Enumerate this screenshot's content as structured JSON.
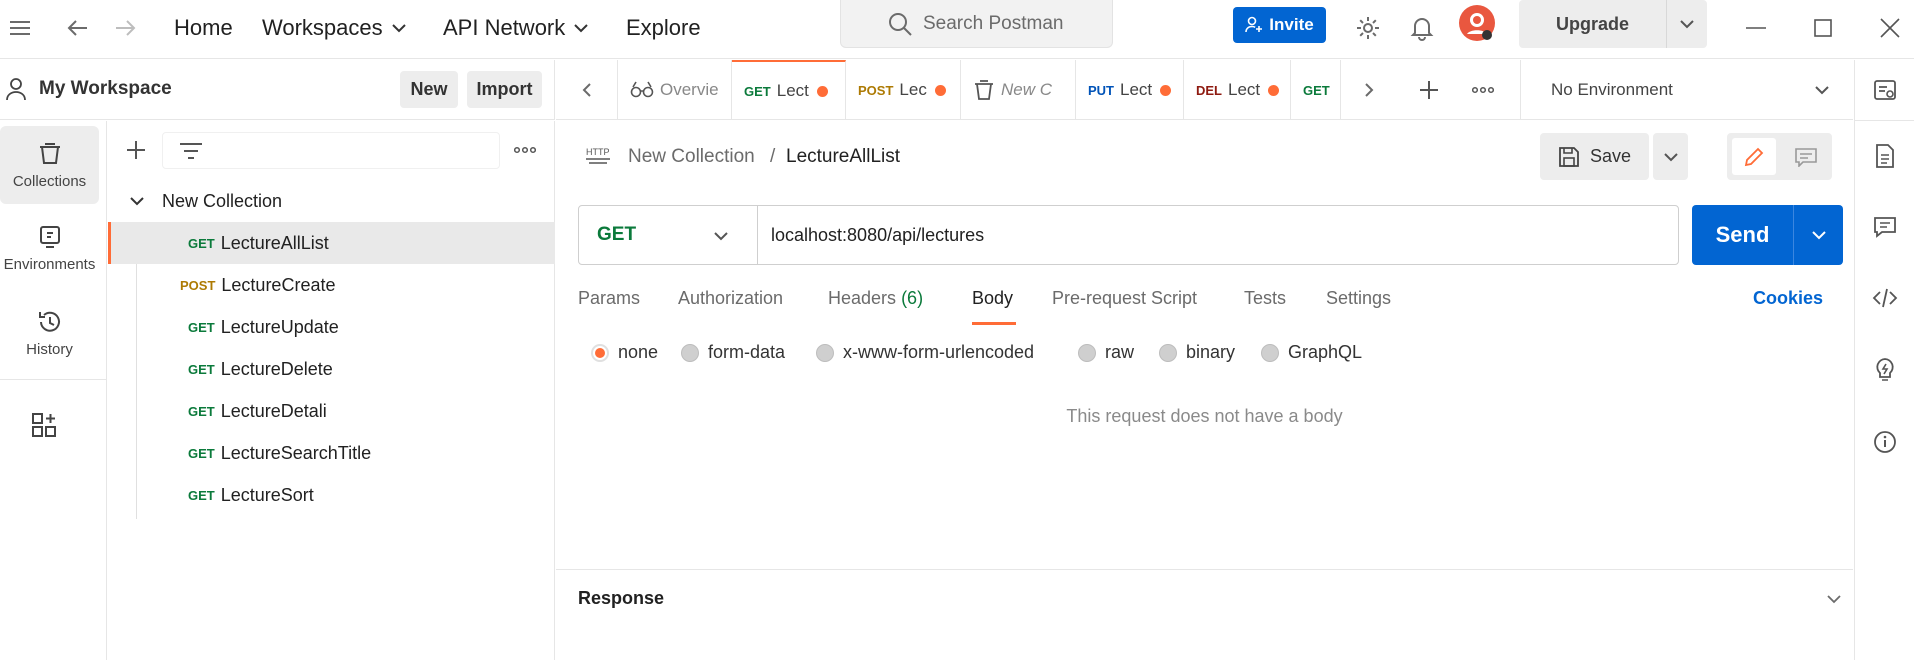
{
  "titlebar": {
    "nav": [
      {
        "label": "Home"
      },
      {
        "label": "Workspaces",
        "has_dropdown": true
      },
      {
        "label": "API Network",
        "has_dropdown": true
      },
      {
        "label": "Explore"
      }
    ],
    "search_placeholder": "Search Postman",
    "invite_label": "Invite",
    "upgrade_label": "Upgrade",
    "icons": [
      "menu-icon",
      "back-arrow-icon",
      "forward-arrow-icon",
      "settings-gear-icon",
      "bell-icon",
      "avatar",
      "minimize-icon",
      "maximize-icon",
      "close-icon"
    ]
  },
  "workspace": {
    "name": "My Workspace",
    "new_label": "New",
    "import_label": "Import"
  },
  "rail": {
    "items": [
      {
        "label": "Collections",
        "icon": "collections-icon",
        "active": true
      },
      {
        "label": "Environments",
        "icon": "environments-icon"
      },
      {
        "label": "History",
        "icon": "history-icon"
      },
      {
        "label": "",
        "icon": "configure-workbench-icon"
      }
    ]
  },
  "sidebar": {
    "collection_name": "New Collection",
    "requests": [
      {
        "method": "GET",
        "name": "LectureAllList",
        "selected": true
      },
      {
        "method": "POST",
        "name": "LectureCreate"
      },
      {
        "method": "GET",
        "name": "LectureUpdate"
      },
      {
        "method": "GET",
        "name": "LectureDelete"
      },
      {
        "method": "GET",
        "name": "LectureDetali"
      },
      {
        "method": "GET",
        "name": "LectureSearchTitle"
      },
      {
        "method": "GET",
        "name": "LectureSort"
      }
    ]
  },
  "tabs": [
    {
      "method": "",
      "label": "Overvie",
      "icon": "overview-icon"
    },
    {
      "method": "GET",
      "label": "Lect",
      "dirty": true,
      "active": true
    },
    {
      "method": "POST",
      "label": "Lec",
      "dirty": true
    },
    {
      "method": "",
      "label": "New C",
      "icon": "collection-icon",
      "italic": true
    },
    {
      "method": "PUT",
      "label": "Lect",
      "dirty": true
    },
    {
      "method": "DEL",
      "label": "Lect",
      "dirty": true
    },
    {
      "method": "GET",
      "label": ""
    }
  ],
  "environment": {
    "selected": "No Environment"
  },
  "request": {
    "breadcrumb_collection": "New Collection",
    "breadcrumb_separator": "/",
    "name": "LectureAllList",
    "save_label": "Save",
    "method": "GET",
    "url": "localhost:8080/api/lectures",
    "send_label": "Send",
    "tabs": [
      {
        "label": "Params"
      },
      {
        "label": "Authorization"
      },
      {
        "label": "Headers",
        "count": "(6)"
      },
      {
        "label": "Body",
        "active": true
      },
      {
        "label": "Pre-request Script"
      },
      {
        "label": "Tests"
      },
      {
        "label": "Settings"
      }
    ],
    "cookies_label": "Cookies",
    "body_types": [
      {
        "label": "none",
        "selected": true
      },
      {
        "label": "form-data"
      },
      {
        "label": "x-www-form-urlencoded"
      },
      {
        "label": "raw"
      },
      {
        "label": "binary"
      },
      {
        "label": "GraphQL"
      }
    ],
    "empty_body_message": "This request does not have a body"
  },
  "response": {
    "label": "Response"
  },
  "colors": {
    "accent": "#ff6c37",
    "primary_blue": "#0265d2",
    "get": "#0b7a3b",
    "post": "#ad7a03",
    "put": "#0053b8",
    "del": "#8e1a10"
  }
}
